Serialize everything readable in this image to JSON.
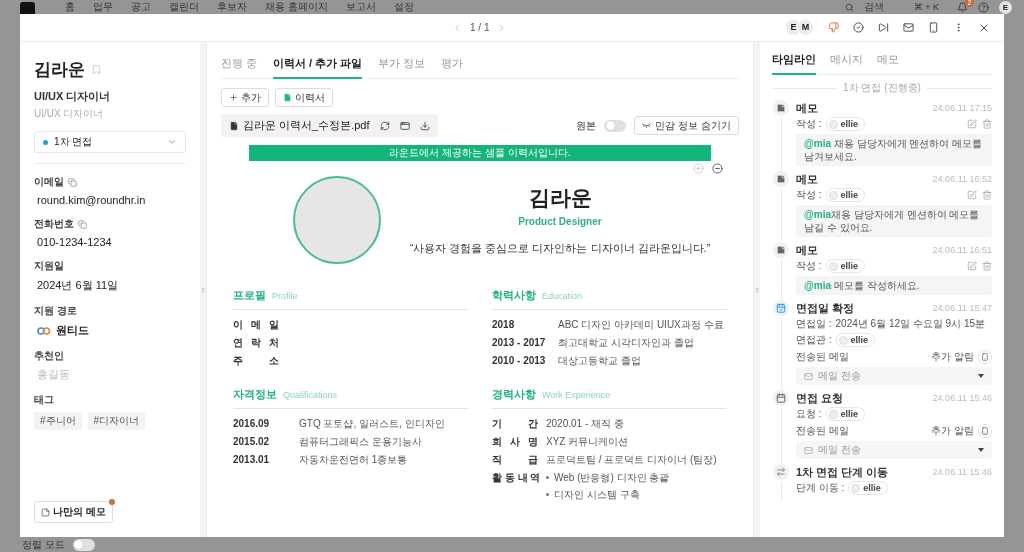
{
  "background_app": {
    "nav": [
      {
        "label": "홈"
      },
      {
        "label": "업무"
      },
      {
        "label": "공고"
      },
      {
        "label": "캘린더"
      },
      {
        "label": "후보자"
      },
      {
        "label": "채용 홈페이지"
      },
      {
        "label": "보고서"
      },
      {
        "label": "설정"
      }
    ],
    "search": {
      "placeholder": "검색",
      "shortcut": "⌘ + K"
    },
    "notification_count": "2",
    "avatar": "E",
    "footer_toggle": {
      "label": "정렬 모드",
      "on": false
    }
  },
  "header": {
    "pagination": "1 / 1",
    "viewers": [
      "E",
      "M"
    ]
  },
  "candidate": {
    "name": "김라운",
    "position": "UI/UX 디자이너",
    "position_sub": "UI/UX 디자이너",
    "stage": "1차 면접",
    "fields": [
      {
        "kind": "text",
        "label": "이메일",
        "copyable": true,
        "value": "round.kim@roundhr.in"
      },
      {
        "kind": "text",
        "label": "전화번호",
        "copyable": true,
        "value": "010-1234-1234"
      },
      {
        "kind": "text",
        "label": "지원일",
        "copyable": false,
        "value": "2024년 6월 11일"
      },
      {
        "kind": "source",
        "label": "지원 경로",
        "copyable": false,
        "value": "원티드"
      },
      {
        "kind": "input",
        "label": "추천인",
        "copyable": false,
        "placeholder": "홍길동"
      },
      {
        "kind": "tags",
        "label": "태그",
        "copyable": false,
        "tags": [
          "#주니어",
          "#디자이너"
        ]
      }
    ],
    "memo_button": {
      "label": "나만의 메모",
      "unread": true
    }
  },
  "center": {
    "tabs": [
      {
        "label": "진행 중",
        "selected": false
      },
      {
        "label": "이력서 / 추가 파일",
        "selected": true
      },
      {
        "label": "부가 정보",
        "selected": false
      },
      {
        "label": "평가",
        "selected": false
      }
    ],
    "buttons": [
      {
        "kind": "add",
        "label": "추가"
      },
      {
        "kind": "file",
        "label": "이력서"
      }
    ],
    "file_name": "김라운 이력서_수정본.pdf",
    "original_toggle": {
      "label": "원본",
      "on": false
    },
    "mask_button": "민감 정보 숨기기",
    "zoom_controls": [
      {
        "kind": "zoom_in",
        "disabled": true
      },
      {
        "kind": "zoom_out",
        "disabled": false
      }
    ],
    "resume": {
      "banner": "라운드에서 제공하는 샘플 이력서입니다.",
      "name": "김라운",
      "role": "Product Designer",
      "quote": "“사용자 경험을 중심으로 디자인하는 디자이너 김라운입니다.”",
      "sections": [
        {
          "kind": "fields",
          "title": "프로필",
          "subtitle": "Profile",
          "rows": [
            {
              "label": "이 메 일"
            },
            {
              "label": "연 락 처"
            },
            {
              "label": "주 소"
            }
          ]
        },
        {
          "kind": "dates",
          "title": "학력사항",
          "subtitle": "Education",
          "rows": [
            {
              "label": "2018",
              "value": "ABC 디자인 아카데미 UIUX과정 수료"
            },
            {
              "label": "2013 - 2017",
              "value": "최고대학교 시각디자인과 졸업"
            },
            {
              "label": "2010 - 2013",
              "value": "대상고등학교 졸업"
            }
          ]
        },
        {
          "kind": "dates",
          "title": "자격정보",
          "subtitle": "Qualifications",
          "rows": [
            {
              "label": "2016.09",
              "value": "GTQ 포토샵, 일러스트, 인디자인"
            },
            {
              "label": "2015.02",
              "value": "컴퓨터그래픽스 운용기능사"
            },
            {
              "label": "2013.01",
              "value": "자동차운전면허 1종보통"
            }
          ]
        },
        {
          "kind": "fields",
          "title": "경력사항",
          "subtitle": "Work Experience",
          "rows": [
            {
              "label": "기 간",
              "value": "2020.01 - 재직 중"
            },
            {
              "label": "회 사 명",
              "value": "XYZ 커뮤니케이션"
            },
            {
              "label": "직 급",
              "value": "프로덕트팀 / 프로덕트 디자이너 (팀장)"
            },
            {
              "label": "활 동 내 역",
              "items": [
                "Web (반응형) 디자인 총괄",
                "디자인 시스템 구축"
              ]
            }
          ]
        }
      ]
    }
  },
  "timeline_panel": {
    "tabs": [
      {
        "label": "타임라인",
        "selected": true
      },
      {
        "label": "메시지",
        "selected": false
      },
      {
        "label": "메모",
        "selected": false
      }
    ],
    "stage": "1차 면접 (진행중)",
    "items": [
      {
        "kind": "memo",
        "title": "메모",
        "time": "24.06.11 17:15",
        "lines": [
          {
            "label": "작성 :",
            "user": "ellie"
          }
        ],
        "note": {
          "mention": "@mia",
          "text": " 채용 담당자에게 멘션하여 메모를 남겨보세요."
        }
      },
      {
        "kind": "memo",
        "title": "메모",
        "time": "24.06.11 16:52",
        "lines": [
          {
            "label": "작성 :",
            "user": "ellie"
          }
        ],
        "note": {
          "mention": "@mia",
          "text": "채용 담당자에게 멘션하여 메모를 남길 수 있어요."
        }
      },
      {
        "kind": "memo",
        "title": "메모",
        "time": "24.06.11 16:51",
        "lines": [
          {
            "label": "작성 :",
            "user": "ellie"
          }
        ],
        "note": {
          "mention": "@mia",
          "text": " 메모를 작성하세요."
        }
      },
      {
        "kind": "schedule_confirmed",
        "title": "면접일 확정",
        "time": "24.06.11 15:47",
        "lines": [
          {
            "label": "면접일 :",
            "value": "2024년 6월 12일 수요일 9시 15분"
          },
          {
            "label": "면접관 :",
            "user": "ellie"
          }
        ],
        "mail": {
          "label": "전송된 메일",
          "action": "추가 알림",
          "dropdown": "메일 전송"
        }
      },
      {
        "kind": "schedule_request",
        "title": "면접 요청",
        "time": "24.06.11 15:46",
        "lines": [
          {
            "label": "요청 :",
            "user": "ellie"
          }
        ],
        "mail": {
          "label": "전송된 메일",
          "action": "추가 알림",
          "dropdown": "메일 전송"
        }
      },
      {
        "kind": "stage_move",
        "title": "1차 면접 단계 이동",
        "time": "24.06.11 15:46",
        "lines": [
          {
            "label": "단계 이동 :",
            "user": "ellie"
          }
        ]
      }
    ]
  }
}
